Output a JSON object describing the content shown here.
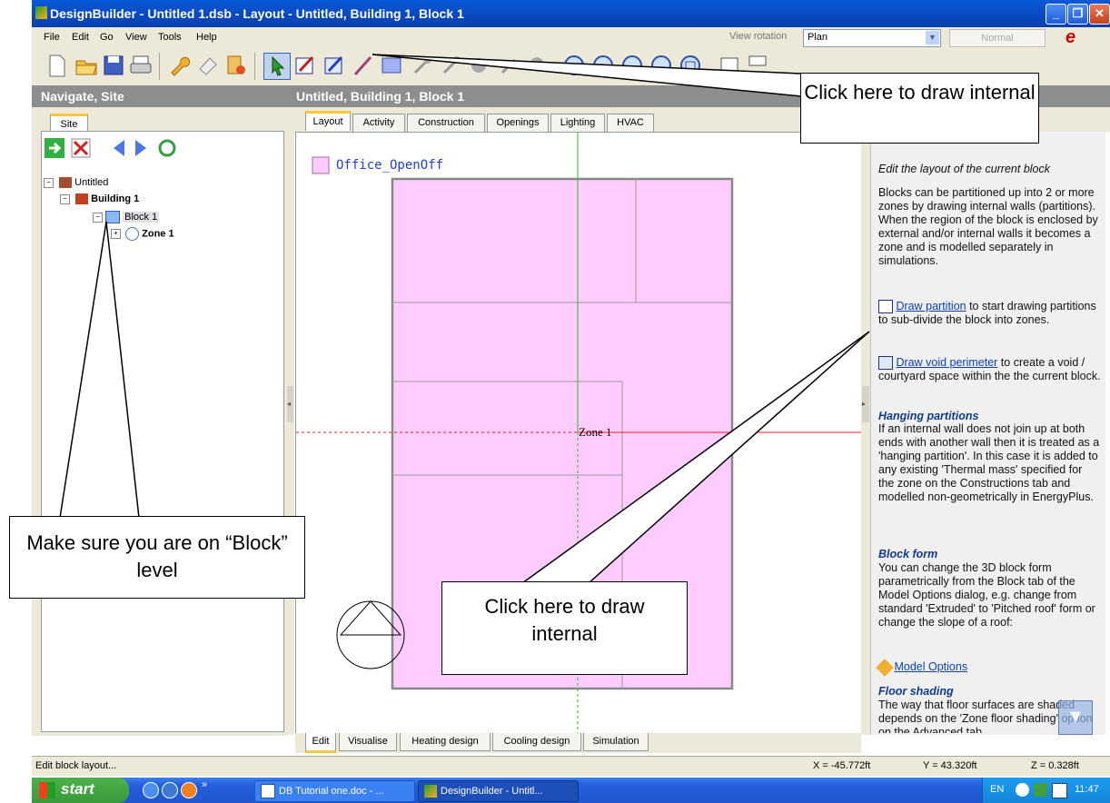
{
  "window": {
    "title": "DesignBuilder - Untitled 1.dsb - Layout - Untitled, Building 1, Block 1"
  },
  "menu": [
    "File",
    "Edit",
    "Go",
    "View",
    "Tools",
    "Help"
  ],
  "view_rotation": {
    "label": "View rotation",
    "value": "Plan",
    "mode": "Normal"
  },
  "left_panel": {
    "title": "Navigate, Site",
    "tab": "Site",
    "tree": [
      "Untitled",
      "Building 1",
      "Block 1",
      "Zone 1"
    ]
  },
  "main": {
    "title": "Untitled, Building 1, Block 1",
    "tabs": [
      "Layout",
      "Activity",
      "Construction",
      "Openings",
      "Lighting",
      "HVAC"
    ],
    "bottom_tabs": [
      "Edit",
      "Visualise",
      "Heating design",
      "Cooling design",
      "Simulation"
    ],
    "legend_label": "Office_OpenOff",
    "zone_label": "Zone 1",
    "legend_color": "#ffccff"
  },
  "help_panel": {
    "subtitle": "Edit the layout of the current block",
    "intro": "Blocks can be partitioned up into 2 or more zones by drawing internal walls (partitions). When the region of the block is enclosed by external and/or internal walls it becomes a zone and is modelled separately in simulations.",
    "draw_partition_link": "Draw partition",
    "draw_partition_text": " to start drawing partitions to sub-divide the block into zones.",
    "draw_void_link": "Draw void perimeter",
    "draw_void_text": " to create a void / courtyard space within the the current block.",
    "hanging_heading": "Hanging partitions",
    "hanging_text": "If an internal wall does not join up at both ends with another wall then it is treated as a 'hanging partition'. In this case it is added to any existing 'Thermal mass' specified for the zone on the Constructions tab and modelled non-geometrically in EnergyPlus.",
    "block_form_heading": "Block form",
    "block_form_text": "You can change the 3D block form parametrically from the Block tab of the Model Options dialog, e.g. change from standard 'Extruded' to 'Pitched roof' form or change the slope of a roof:",
    "model_options_link": "Model Options",
    "floor_shading_heading": "Floor shading",
    "floor_shading_text": "The way that floor surfaces are shaded depends on the 'Zone floor shading' option on the Advanced tab"
  },
  "status": {
    "text": "Edit block layout...",
    "x": "X = -45.772ft",
    "y": "Y = 43.320ft",
    "z": "Z = 0.328ft"
  },
  "taskbar": {
    "start": "start",
    "items": [
      "DB Tutorial one.doc - ...",
      "DesignBuilder - Untitl..."
    ],
    "lang": "EN",
    "clock": "11:47"
  },
  "callouts": {
    "top": "Click here to draw internal",
    "bottom": "Click here to draw internal",
    "left": "Make sure you are on “Block” level"
  }
}
